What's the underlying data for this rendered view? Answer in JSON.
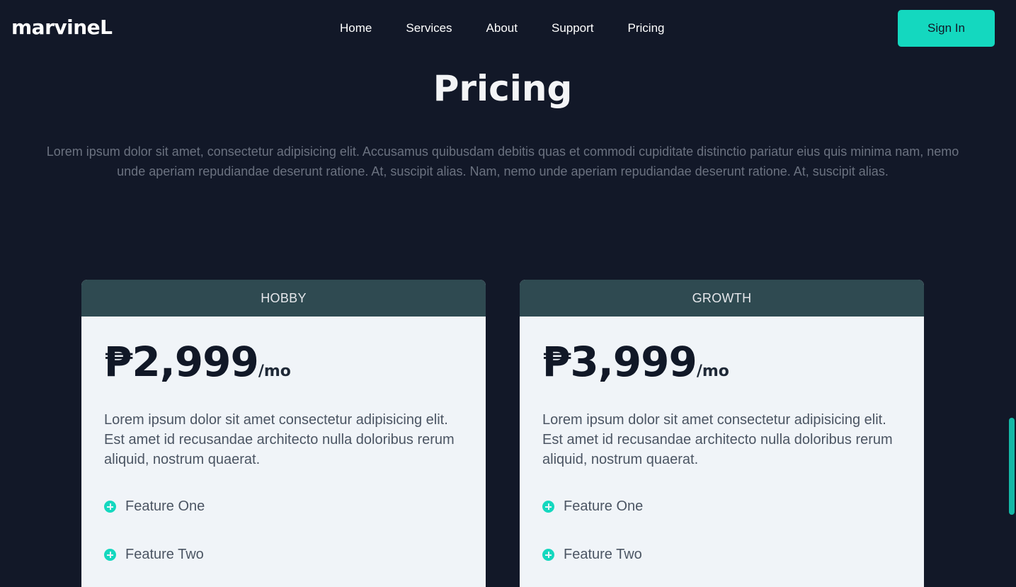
{
  "brand": {
    "logo": "marvineL"
  },
  "nav": {
    "items": [
      {
        "label": "Home"
      },
      {
        "label": "Services"
      },
      {
        "label": "About"
      },
      {
        "label": "Support"
      },
      {
        "label": "Pricing"
      }
    ],
    "signin_label": "Sign In"
  },
  "section": {
    "title": "Pricing",
    "intro": "Lorem ipsum dolor sit amet, consectetur adipisicing elit. Accusamus quibusdam debitis quas et commodi cupiditate distinctio pariatur eius quis minima nam, nemo unde aperiam repudiandae deserunt ratione. At, suscipit alias. Nam, nemo unde aperiam repudiandae deserunt ratione. At, suscipit alias."
  },
  "plans": [
    {
      "name": "HOBBY",
      "price": "₱2,999",
      "period": "/mo",
      "description": "Lorem ipsum dolor sit amet consectetur adipisicing elit. Est amet id recusandae architecto nulla doloribus rerum aliquid, nostrum quaerat.",
      "features": [
        "Feature One",
        "Feature Two"
      ]
    },
    {
      "name": "GROWTH",
      "price": "₱3,999",
      "period": "/mo",
      "description": "Lorem ipsum dolor sit amet consectetur adipisicing elit. Est amet id recusandae architecto nulla doloribus rerum aliquid, nostrum quaerat.",
      "features": [
        "Feature One",
        "Feature Two"
      ]
    }
  ],
  "colors": {
    "background": "#121828",
    "accent": "#14d8bf",
    "card_header": "#2f4a51",
    "card_body": "#f0f4f8"
  },
  "icons": {
    "feature_bullet": "plus-circle-icon"
  }
}
